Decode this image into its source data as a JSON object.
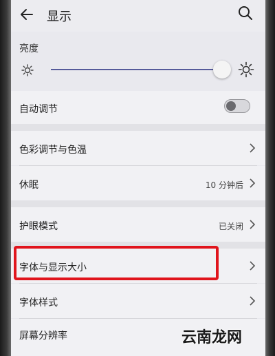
{
  "header": {
    "title": "显示",
    "back_icon": "arrow-left-icon",
    "search_icon": "search-icon"
  },
  "brightness": {
    "label": "亮度",
    "level": 0.95,
    "low_icon": "sun-small-icon",
    "high_icon": "sun-large-icon"
  },
  "auto_adjust": {
    "label": "自动调节",
    "enabled": false
  },
  "settings": {
    "color_temp": {
      "label": "色彩调节与色温"
    },
    "sleep": {
      "label": "休眠",
      "value": "10 分钟后"
    },
    "eye_comfort": {
      "label": "护眼模式",
      "value": "已关闭"
    },
    "font_display_size": {
      "label": "字体与显示大小",
      "highlighted": true
    },
    "font_style": {
      "label": "字体样式"
    },
    "resolution": {
      "label": "屏幕分辨率"
    }
  },
  "watermark": "云南龙网",
  "colors": {
    "highlight": "#e0141c",
    "slider": "#555a9a"
  }
}
